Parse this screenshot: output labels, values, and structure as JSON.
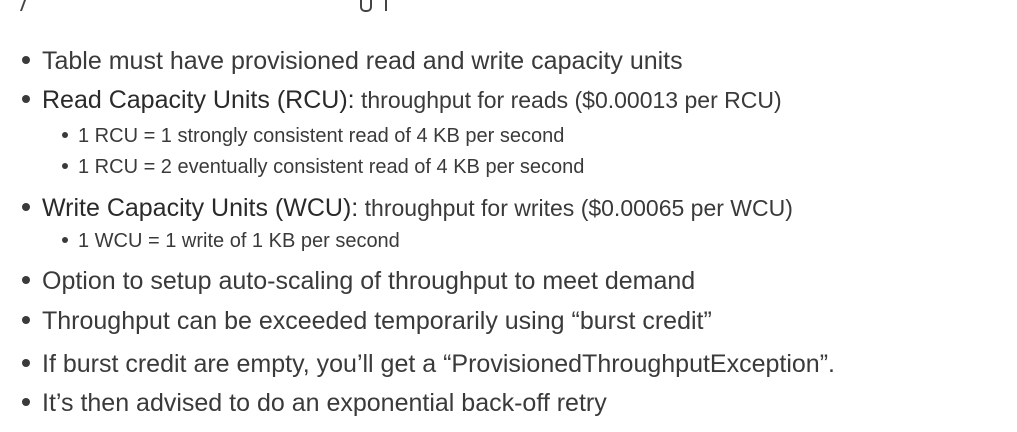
{
  "bullets": [
    {
      "text": "Table must have provisioned read and write capacity units"
    },
    {
      "term": "Read Capacity Units (RCU):",
      "text": " throughput for reads ($0.00013 per RCU)"
    },
    {
      "text": "1 RCU = 1 strongly consistent read of 4 KB per second",
      "level": 2
    },
    {
      "text": "1 RCU = 2 eventually consistent read of 4 KB per second",
      "level": 2
    },
    {
      "term": "Write Capacity Units (WCU):",
      "text": " throughput for writes ($0.00065 per WCU)"
    },
    {
      "text": "1 WCU = 1 write of 1 KB per second",
      "level": 2
    },
    {
      "text": "Option to setup auto-scaling of throughput to meet demand"
    },
    {
      "text": "Throughput can be exceeded temporarily using “burst credit”"
    },
    {
      "text": "If burst credit are empty, you’ll get a “ProvisionedThroughputException”."
    },
    {
      "text": "It’s then advised to do an exponential back-off retry"
    }
  ]
}
